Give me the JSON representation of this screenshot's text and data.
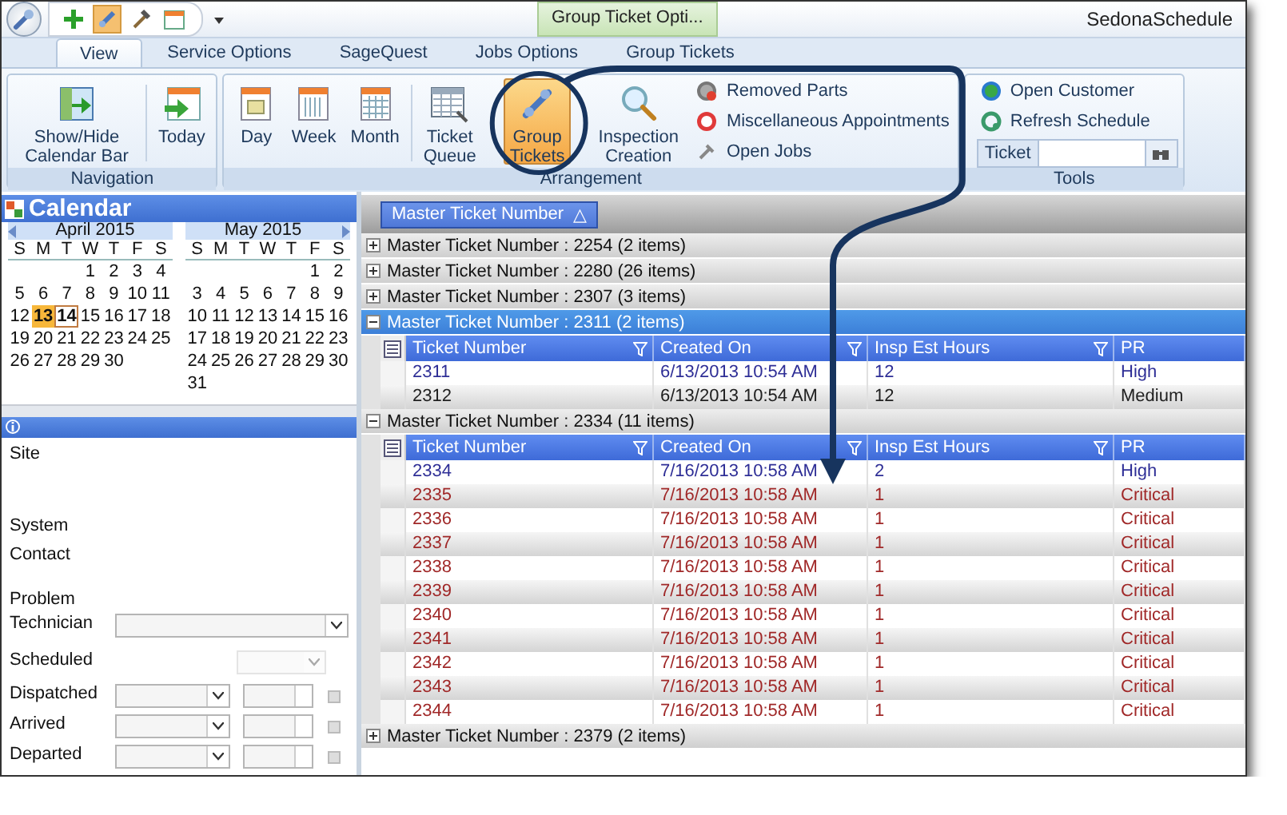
{
  "title_bar": {
    "context_tab": "Group Ticket Opti...",
    "title": "SedonaSchedule"
  },
  "tabs": [
    {
      "label": "View",
      "selected": true
    },
    {
      "label": "Service Options",
      "selected": false
    },
    {
      "label": "SageQuest",
      "selected": false
    },
    {
      "label": "Jobs Options",
      "selected": false
    },
    {
      "label": "Group Tickets",
      "selected": false
    }
  ],
  "ribbon": {
    "groups": [
      {
        "label": "Navigation",
        "buttons": [
          {
            "label": "Show/Hide Calendar Bar",
            "selected": false
          },
          {
            "label": "Today",
            "selected": false
          }
        ]
      },
      {
        "label": "Arrangement",
        "buttons": [
          {
            "label": "Day",
            "selected": false
          },
          {
            "label": "Week",
            "selected": false
          },
          {
            "label": "Month",
            "selected": false
          },
          {
            "label": "Ticket Queue",
            "selected": false
          },
          {
            "label": "Group Tickets",
            "selected": true
          },
          {
            "label": "Inspection Creation",
            "selected": false
          }
        ],
        "small": [
          "Removed Parts",
          "Miscellaneous Appointments",
          "Open Jobs"
        ]
      },
      {
        "label": "Tools",
        "small": [
          "Open Customer",
          "Refresh Schedule"
        ],
        "field": {
          "label": "Ticket"
        }
      }
    ]
  },
  "calendar": {
    "title": "Calendar",
    "months": [
      {
        "name": "April 2015",
        "weekdays": [
          "S",
          "M",
          "T",
          "W",
          "T",
          "F",
          "S"
        ],
        "weeks": [
          {
            "kind": "leading",
            "days": [
              {
                "d": "1",
                "selected": false,
                "today": false
              },
              {
                "d": "2",
                "selected": false,
                "today": false
              },
              {
                "d": "3",
                "selected": false,
                "today": false
              },
              {
                "d": "4",
                "selected": false,
                "today": false
              }
            ]
          },
          {
            "kind": "regular",
            "days": [
              {
                "d": "5",
                "selected": false,
                "today": false
              },
              {
                "d": "6",
                "selected": false,
                "today": false
              },
              {
                "d": "7",
                "selected": false,
                "today": false
              },
              {
                "d": "8",
                "selected": false,
                "today": false
              },
              {
                "d": "9",
                "selected": false,
                "today": false
              },
              {
                "d": "10",
                "selected": false,
                "today": false
              },
              {
                "d": "11",
                "selected": false,
                "today": false
              }
            ]
          },
          {
            "kind": "regular",
            "days": [
              {
                "d": "12",
                "selected": false,
                "today": false
              },
              {
                "d": "13",
                "selected": true,
                "today": false
              },
              {
                "d": "14",
                "selected": false,
                "today": true
              },
              {
                "d": "15",
                "selected": false,
                "today": false
              },
              {
                "d": "16",
                "selected": false,
                "today": false
              },
              {
                "d": "17",
                "selected": false,
                "today": false
              },
              {
                "d": "18",
                "selected": false,
                "today": false
              }
            ]
          },
          {
            "kind": "regular",
            "days": [
              {
                "d": "19",
                "selected": false,
                "today": false
              },
              {
                "d": "20",
                "selected": false,
                "today": false
              },
              {
                "d": "21",
                "selected": false,
                "today": false
              },
              {
                "d": "22",
                "selected": false,
                "today": false
              },
              {
                "d": "23",
                "selected": false,
                "today": false
              },
              {
                "d": "24",
                "selected": false,
                "today": false
              },
              {
                "d": "25",
                "selected": false,
                "today": false
              }
            ]
          },
          {
            "kind": "regular",
            "days": [
              {
                "d": "26",
                "selected": false,
                "today": false
              },
              {
                "d": "27",
                "selected": false,
                "today": false
              },
              {
                "d": "28",
                "selected": false,
                "today": false
              },
              {
                "d": "29",
                "selected": false,
                "today": false
              },
              {
                "d": "30",
                "selected": false,
                "today": false
              }
            ]
          }
        ]
      },
      {
        "name": "May 2015",
        "weekdays": [
          "S",
          "M",
          "T",
          "W",
          "T",
          "F",
          "S"
        ],
        "weeks": [
          {
            "kind": "leading",
            "days": [
              {
                "d": "1",
                "selected": false,
                "today": false
              },
              {
                "d": "2",
                "selected": false,
                "today": false
              }
            ]
          },
          {
            "kind": "regular",
            "days": [
              {
                "d": "3",
                "selected": false,
                "today": false
              },
              {
                "d": "4",
                "selected": false,
                "today": false
              },
              {
                "d": "5",
                "selected": false,
                "today": false
              },
              {
                "d": "6",
                "selected": false,
                "today": false
              },
              {
                "d": "7",
                "selected": false,
                "today": false
              },
              {
                "d": "8",
                "selected": false,
                "today": false
              },
              {
                "d": "9",
                "selected": false,
                "today": false
              }
            ]
          },
          {
            "kind": "regular",
            "days": [
              {
                "d": "10",
                "selected": false,
                "today": false
              },
              {
                "d": "11",
                "selected": false,
                "today": false
              },
              {
                "d": "12",
                "selected": false,
                "today": false
              },
              {
                "d": "13",
                "selected": false,
                "today": false
              },
              {
                "d": "14",
                "selected": false,
                "today": false
              },
              {
                "d": "15",
                "selected": false,
                "today": false
              },
              {
                "d": "16",
                "selected": false,
                "today": false
              }
            ]
          },
          {
            "kind": "regular",
            "days": [
              {
                "d": "17",
                "selected": false,
                "today": false
              },
              {
                "d": "18",
                "selected": false,
                "today": false
              },
              {
                "d": "19",
                "selected": false,
                "today": false
              },
              {
                "d": "20",
                "selected": false,
                "today": false
              },
              {
                "d": "21",
                "selected": false,
                "today": false
              },
              {
                "d": "22",
                "selected": false,
                "today": false
              },
              {
                "d": "23",
                "selected": false,
                "today": false
              }
            ]
          },
          {
            "kind": "regular",
            "days": [
              {
                "d": "24",
                "selected": false,
                "today": false
              },
              {
                "d": "25",
                "selected": false,
                "today": false
              },
              {
                "d": "26",
                "selected": false,
                "today": false
              },
              {
                "d": "27",
                "selected": false,
                "today": false
              },
              {
                "d": "28",
                "selected": false,
                "today": false
              },
              {
                "d": "29",
                "selected": false,
                "today": false
              },
              {
                "d": "30",
                "selected": false,
                "today": false
              }
            ]
          },
          {
            "kind": "regular",
            "days": [
              {
                "d": "31",
                "selected": false,
                "today": false
              }
            ]
          }
        ]
      }
    ]
  },
  "details": {
    "fields": [
      {
        "label": "Site",
        "kind": "tall"
      },
      {
        "label": "System",
        "kind": "plain"
      },
      {
        "label": "Contact",
        "kind": "medium"
      },
      {
        "label": "Problem",
        "kind": "short"
      },
      {
        "label": "Technician",
        "kind": "combo"
      },
      {
        "label": "Scheduled",
        "kind": "disabled_combo"
      },
      {
        "label": "Dispatched",
        "kind": "datetime"
      },
      {
        "label": "Arrived",
        "kind": "datetime"
      },
      {
        "label": "Departed",
        "kind": "datetime"
      }
    ]
  },
  "grid": {
    "group_by": "Master Ticket Number",
    "sort_mark": "△",
    "groups": [
      {
        "label": "Master Ticket Number : 2254 (2 items)",
        "expanded": false,
        "selected": false
      },
      {
        "label": "Master Ticket Number : 2280 (26 items)",
        "expanded": false,
        "selected": false
      },
      {
        "label": "Master Ticket Number : 2307 (3 items)",
        "expanded": false,
        "selected": false
      },
      {
        "label": "Master Ticket Number : 2311 (2 items)",
        "expanded": true,
        "selected": true,
        "columns": [
          "Ticket Number",
          "Created On",
          "Insp Est Hours",
          "PR"
        ],
        "rows": [
          {
            "cells": [
              "2311",
              "6/13/2013 10:54 AM",
              "12",
              "High"
            ],
            "color": "#2e2e96"
          },
          {
            "cells": [
              "2312",
              "6/13/2013 10:54 AM",
              "12",
              "Medium"
            ],
            "color": "#202020"
          }
        ]
      },
      {
        "label": "Master Ticket Number : 2334 (11 items)",
        "expanded": true,
        "selected": false,
        "columns": [
          "Ticket Number",
          "Created On",
          "Insp Est Hours",
          "PR"
        ],
        "rows": [
          {
            "cells": [
              "2334",
              "7/16/2013 10:58 AM",
              "2",
              "High"
            ],
            "color": "#2e2e96"
          },
          {
            "cells": [
              "2335",
              "7/16/2013 10:58 AM",
              "1",
              "Critical"
            ],
            "color": "#a02828"
          },
          {
            "cells": [
              "2336",
              "7/16/2013 10:58 AM",
              "1",
              "Critical"
            ],
            "color": "#a02828"
          },
          {
            "cells": [
              "2337",
              "7/16/2013 10:58 AM",
              "1",
              "Critical"
            ],
            "color": "#a02828"
          },
          {
            "cells": [
              "2338",
              "7/16/2013 10:58 AM",
              "1",
              "Critical"
            ],
            "color": "#a02828"
          },
          {
            "cells": [
              "2339",
              "7/16/2013 10:58 AM",
              "1",
              "Critical"
            ],
            "color": "#a02828"
          },
          {
            "cells": [
              "2340",
              "7/16/2013 10:58 AM",
              "1",
              "Critical"
            ],
            "color": "#a02828"
          },
          {
            "cells": [
              "2341",
              "7/16/2013 10:58 AM",
              "1",
              "Critical"
            ],
            "color": "#a02828"
          },
          {
            "cells": [
              "2342",
              "7/16/2013 10:58 AM",
              "1",
              "Critical"
            ],
            "color": "#a02828"
          },
          {
            "cells": [
              "2343",
              "7/16/2013 10:58 AM",
              "1",
              "Critical"
            ],
            "color": "#a02828"
          },
          {
            "cells": [
              "2344",
              "7/16/2013 10:58 AM",
              "1",
              "Critical"
            ],
            "color": "#a02828"
          }
        ]
      },
      {
        "label": "Master Ticket Number : 2379 (2 items)",
        "expanded": false,
        "selected": false
      }
    ]
  }
}
